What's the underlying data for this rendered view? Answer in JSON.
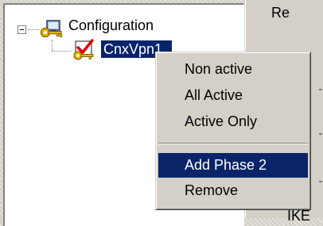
{
  "tree": {
    "root_label": "Configuration",
    "child_label": "CnxVpn1"
  },
  "right_panel": {
    "top_label": "Re",
    "bottom_label": "IKE"
  },
  "context_menu": {
    "items": [
      {
        "label": "Non active"
      },
      {
        "label": "All Active"
      },
      {
        "label": "Active Only"
      },
      {
        "label": "Add Phase 2"
      },
      {
        "label": "Remove"
      }
    ],
    "highlighted": "Add Phase 2"
  },
  "colors": {
    "selection": "#0a246a",
    "panel": "#d4d0c8",
    "key_icon": "#e8b400",
    "check_mark": "#e00000"
  },
  "icons": [
    "collapse-icon",
    "configuration-key-icon",
    "vpn-connection-icon"
  ]
}
